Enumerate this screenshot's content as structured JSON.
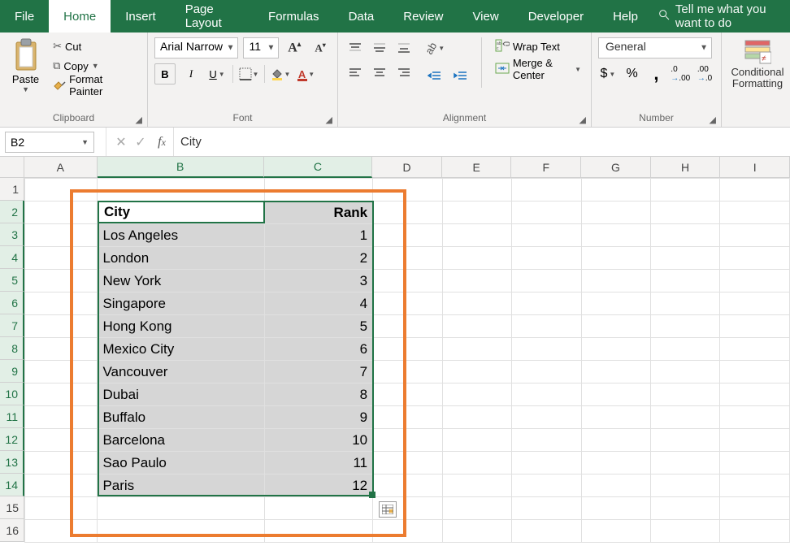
{
  "tabs": {
    "file": "File",
    "home": "Home",
    "insert": "Insert",
    "page_layout": "Page Layout",
    "formulas": "Formulas",
    "data": "Data",
    "review": "Review",
    "view": "View",
    "developer": "Developer",
    "help": "Help",
    "tell_me": "Tell me what you want to do"
  },
  "ribbon": {
    "clipboard": {
      "paste": "Paste",
      "cut": "Cut",
      "copy": "Copy",
      "format_painter": "Format Painter",
      "label": "Clipboard"
    },
    "font": {
      "name": "Arial Narrow",
      "size": "11",
      "bold": "B",
      "italic": "I",
      "underline": "U",
      "label": "Font"
    },
    "alignment": {
      "wrap": "Wrap Text",
      "merge": "Merge & Center",
      "label": "Alignment"
    },
    "number": {
      "format": "General",
      "label": "Number"
    },
    "styles": {
      "cond_fmt": "Conditional\nFormatting"
    }
  },
  "namebox": "B2",
  "formula_value": "City",
  "columns": [
    "A",
    "B",
    "C",
    "D",
    "E",
    "F",
    "G",
    "H",
    "I"
  ],
  "rows": [
    "1",
    "2",
    "3",
    "4",
    "5",
    "6",
    "7",
    "8",
    "9",
    "10",
    "11",
    "12",
    "13",
    "14",
    "15",
    "16"
  ],
  "table": {
    "headers": {
      "city": "City",
      "rank": "Rank"
    },
    "rows": [
      {
        "city": "Los Angeles",
        "rank": "1"
      },
      {
        "city": "London",
        "rank": "2"
      },
      {
        "city": "New York",
        "rank": "3"
      },
      {
        "city": "Singapore",
        "rank": "4"
      },
      {
        "city": "Hong Kong",
        "rank": "5"
      },
      {
        "city": "Mexico City",
        "rank": "6"
      },
      {
        "city": "Vancouver",
        "rank": "7"
      },
      {
        "city": "Dubai",
        "rank": "8"
      },
      {
        "city": "Buffalo",
        "rank": "9"
      },
      {
        "city": "Barcelona",
        "rank": "10"
      },
      {
        "city": "Sao Paulo",
        "rank": "11"
      },
      {
        "city": "Paris",
        "rank": "12"
      }
    ]
  },
  "symbols": {
    "dollar": "$",
    "percent": "%",
    "comma": ",",
    "dec_inc": ".0",
    "dec_dec": ".00"
  }
}
